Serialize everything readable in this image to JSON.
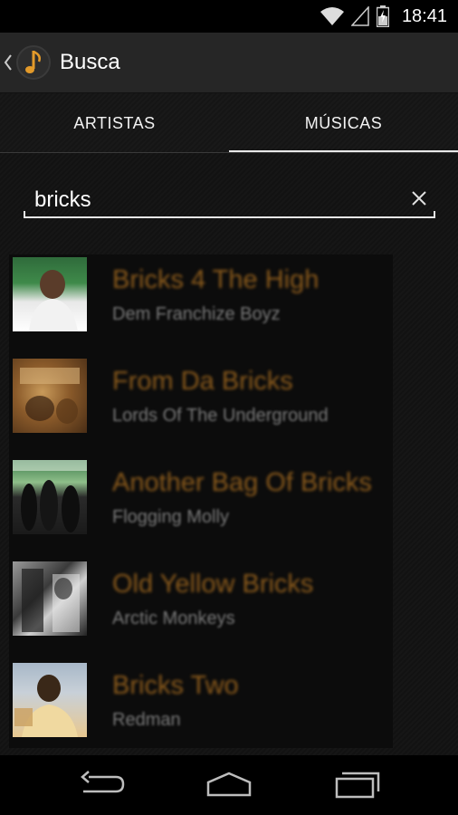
{
  "status": {
    "time": "18:41"
  },
  "actionbar": {
    "title": "Busca"
  },
  "tabs": [
    {
      "label": "ARTISTAS",
      "selected": false
    },
    {
      "label": "MÚSICAS",
      "selected": true
    }
  ],
  "search": {
    "value": "bricks"
  },
  "results": [
    {
      "title": "Bricks 4 The High",
      "artist": "Dem Franchize Boyz"
    },
    {
      "title": "From Da Bricks",
      "artist": "Lords Of The Underground"
    },
    {
      "title": "Another Bag Of Bricks",
      "artist": "Flogging Molly"
    },
    {
      "title": "Old Yellow Bricks",
      "artist": "Arctic Monkeys"
    },
    {
      "title": "Bricks Two",
      "artist": "Redman"
    }
  ],
  "colors": {
    "accent": "#8a5a1c",
    "background": "#141414"
  }
}
